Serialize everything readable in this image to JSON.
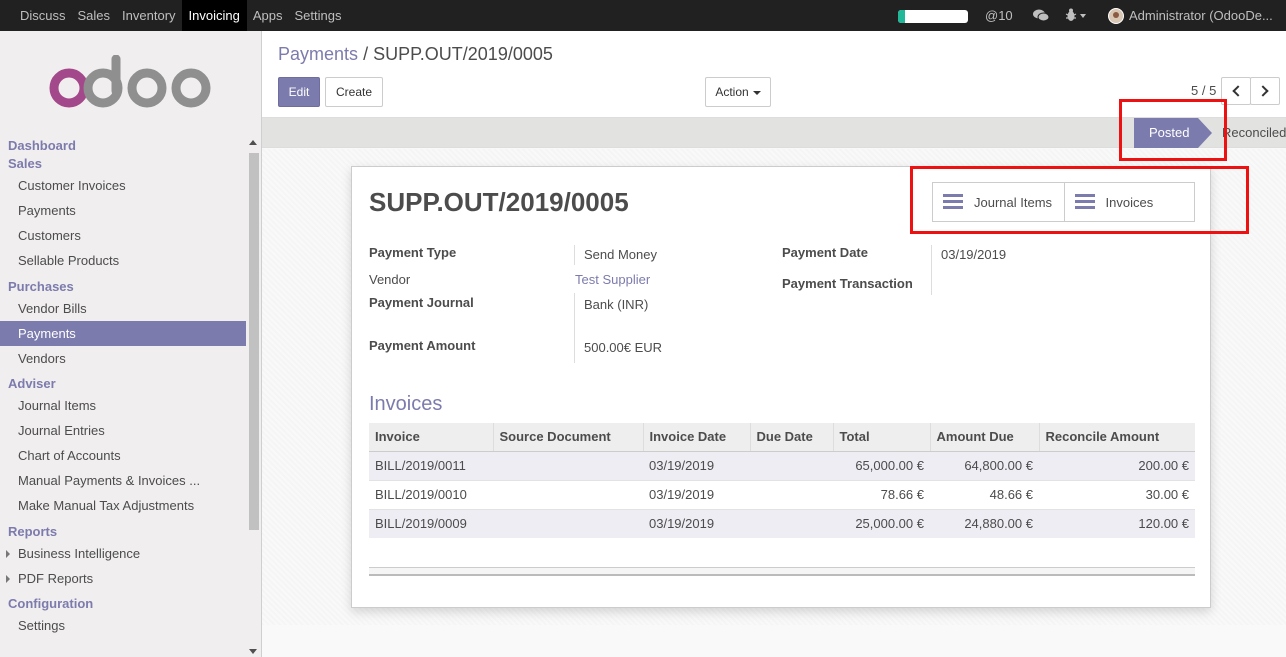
{
  "navbar": {
    "menus": [
      "Discuss",
      "Sales",
      "Inventory",
      "Invoicing",
      "Apps",
      "Settings"
    ],
    "active_menu": "Invoicing",
    "progress_fraction": 0.1,
    "mentions_count": "@10",
    "user": "Administrator (OdooDe...",
    "colors": {
      "bg": "#212121",
      "progress": "#21b799"
    }
  },
  "sidebar": {
    "sections": [
      {
        "title": "Dashboard",
        "items": []
      },
      {
        "title": "Sales",
        "items": [
          "Customer Invoices",
          "Payments",
          "Customers",
          "Sellable Products"
        ]
      },
      {
        "title": "Purchases",
        "items": [
          "Vendor Bills",
          "Payments",
          "Vendors"
        ]
      },
      {
        "title": "Adviser",
        "items": [
          "Journal Items",
          "Journal Entries",
          "Chart of Accounts",
          "Manual Payments & Invoices ...",
          "Make Manual Tax Adjustments"
        ]
      },
      {
        "title": "Reports",
        "items": [
          "Business Intelligence",
          "PDF Reports"
        ]
      },
      {
        "title": "Configuration",
        "items": [
          "Settings"
        ]
      }
    ],
    "active_item": "Purchases/Payments",
    "accent": "#7c7bad"
  },
  "control": {
    "breadcrumb_parent": "Payments",
    "breadcrumb_sep": "/",
    "breadcrumb_current": "SUPP.OUT/2019/0005",
    "edit_label": "Edit",
    "create_label": "Create",
    "action_label": "Action",
    "pager": "5 / 5"
  },
  "status": {
    "current": "Posted",
    "next": "Reconciled"
  },
  "form": {
    "title": "SUPP.OUT/2019/0005",
    "smart_buttons": [
      "Journal Items",
      "Invoices"
    ],
    "payment_type_label": "Payment Type",
    "payment_type": "Send Money",
    "vendor_label": "Vendor",
    "vendor": "Test Supplier",
    "journal_label": "Payment Journal",
    "journal": "Bank (INR)",
    "amount_label": "Payment Amount",
    "amount": "500.00€",
    "currency": "EUR",
    "date_label": "Payment Date",
    "date": "03/19/2019",
    "transaction_label": "Payment Transaction",
    "transaction": ""
  },
  "invoices": {
    "title": "Invoices",
    "columns": [
      "Invoice",
      "Source Document",
      "Invoice Date",
      "Due Date",
      "Total",
      "Amount Due",
      "Reconcile Amount"
    ],
    "rows": [
      [
        "BILL/2019/0011",
        "",
        "03/19/2019",
        "",
        "65,000.00 €",
        "64,800.00 €",
        "200.00 €"
      ],
      [
        "BILL/2019/0010",
        "",
        "03/19/2019",
        "",
        "78.66 €",
        "48.66 €",
        "30.00 €"
      ],
      [
        "BILL/2019/0009",
        "",
        "03/19/2019",
        "",
        "25,000.00 €",
        "24,880.00 €",
        "120.00 €"
      ]
    ]
  }
}
